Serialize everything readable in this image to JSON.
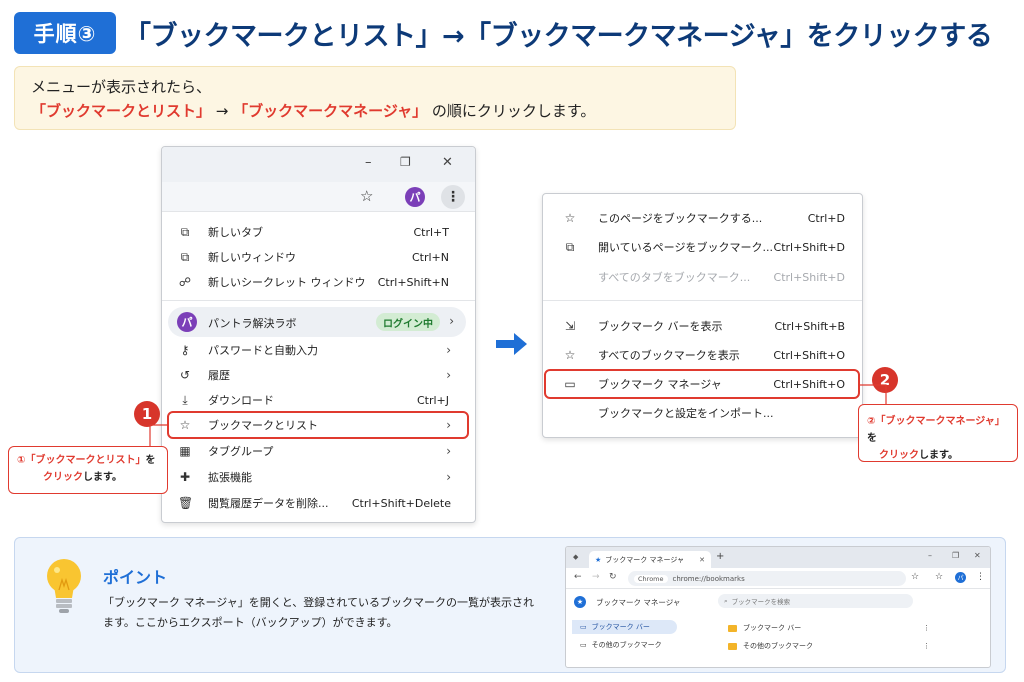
{
  "header": {
    "step_badge": "手順③",
    "title": "「ブックマークとリスト」→「ブックマークマネージャ」をクリックする"
  },
  "instruction": {
    "line1": "メニューが表示されたら、",
    "highlight1": "「ブックマークとリスト」",
    "arrow": " → ",
    "highlight2": "「ブックマークマネージャ」",
    "tail": " の順にクリックします。"
  },
  "browser_menu": {
    "window_controls": {
      "minimize": "–",
      "restore": "❐",
      "close": "✕"
    },
    "avatar_letter": "パ",
    "items": [
      {
        "icon": "new-tab-icon",
        "label": "新しいタブ",
        "shortcut": "Ctrl+T"
      },
      {
        "icon": "new-window-icon",
        "label": "新しいウィンドウ",
        "shortcut": "Ctrl+N"
      },
      {
        "icon": "incognito-icon",
        "label": "新しいシークレット ウィンドウ",
        "shortcut": "Ctrl+Shift+N"
      }
    ],
    "profile": {
      "avatar_letter": "パ",
      "name": "パントラ解決ラボ",
      "status": "ログイン中"
    },
    "items2": [
      {
        "icon": "key-icon",
        "label": "パスワードと自動入力"
      },
      {
        "icon": "history-icon",
        "label": "履歴"
      },
      {
        "icon": "download-icon",
        "label": "ダウンロード",
        "shortcut": "Ctrl+J"
      },
      {
        "icon": "star-icon",
        "label": "ブックマークとリスト"
      },
      {
        "icon": "tab-groups-icon",
        "label": "タブグループ"
      },
      {
        "icon": "extension-icon",
        "label": "拡張機能"
      },
      {
        "icon": "trash-icon",
        "label": "閲覧履歴データを削除...",
        "shortcut": "Ctrl+Shift+Delete"
      }
    ]
  },
  "bookmark_menu": {
    "items": [
      {
        "icon": "star-icon",
        "label": "このページをブックマークする...",
        "shortcut": "Ctrl+D",
        "disabled": false
      },
      {
        "icon": "bookmark-all-icon",
        "label": "開いているページをブックマーク...",
        "shortcut": "Ctrl+Shift+D",
        "disabled": false
      },
      {
        "icon": "",
        "label": "すべてのタブをブックマーク...",
        "shortcut": "Ctrl+Shift+D",
        "disabled": true
      },
      {
        "icon": "bookmark-bar-icon",
        "label": "ブックマーク バーを表示",
        "shortcut": "Ctrl+Shift+B",
        "disabled": false
      },
      {
        "icon": "star-icon",
        "label": "すべてのブックマークを表示",
        "shortcut": "Ctrl+Shift+O",
        "disabled": false
      },
      {
        "icon": "folder-icon",
        "label": "ブックマーク マネージャ",
        "shortcut": "Ctrl+Shift+O",
        "disabled": false
      },
      {
        "icon": "",
        "label": "ブックマークと設定をインポート...",
        "shortcut": "",
        "disabled": false
      }
    ]
  },
  "callouts": {
    "badge1": "1",
    "badge2": "2",
    "c1_prefix": "①",
    "c1_red": "「ブックマークとリスト」",
    "c1_tail": "を",
    "c1_red2": "クリック",
    "c1_end": "します。",
    "c2_prefix": "②",
    "c2_red": "「ブックマークマネージャ」",
    "c2_tail": "を",
    "c2_red2": "クリック",
    "c2_end": "します。"
  },
  "point": {
    "title": "ポイント",
    "text": "「ブックマーク マネージャ」を開くと、登録されているブックマークの一覧が表示されます。ここからエクスポート（バックアップ）ができます。"
  },
  "mini_screenshot": {
    "tab_title": "ブックマーク マネージャ",
    "new_tab": "+",
    "url_chip": "Chrome",
    "url": "chrome://bookmarks",
    "page_title": "ブックマーク マネージャ",
    "search_placeholder": "ブックマークを検索",
    "sidebar": [
      "ブックマーク バー",
      "その他のブックマーク"
    ],
    "list": [
      "ブックマーク バー",
      "その他のブックマーク"
    ],
    "avatar_letter": "パ"
  },
  "colors": {
    "accent_blue": "#1f6fd6",
    "heading_navy": "#0d3a78",
    "highlight_red": "#e03a2f",
    "instruction_bg": "#fdf6e3",
    "point_bg": "#eef4fc"
  }
}
